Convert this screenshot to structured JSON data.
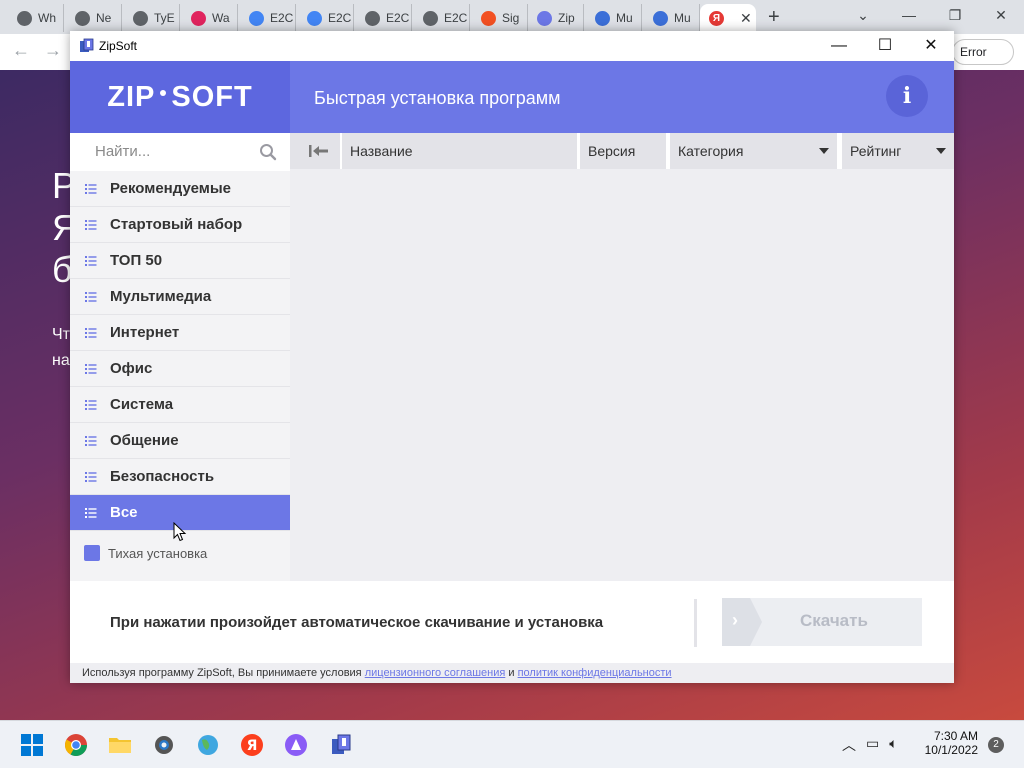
{
  "browser": {
    "tabs": [
      {
        "label": "Wh",
        "color": "#5f6368"
      },
      {
        "label": "Ne",
        "color": "#5f6368"
      },
      {
        "label": "TyE",
        "color": "#5f6368"
      },
      {
        "label": "Wa",
        "color": "#e0245e"
      },
      {
        "label": "E2C",
        "color": "#4285f4"
      },
      {
        "label": "E2C",
        "color": "#4285f4"
      },
      {
        "label": "E2C",
        "color": "#5f6368"
      },
      {
        "label": "E2C",
        "color": "#5f6368"
      },
      {
        "label": "Sig",
        "color": "#f25022"
      },
      {
        "label": "Zip",
        "color": "#6c77e6"
      },
      {
        "label": "Mu",
        "color": "#3b6fd8"
      },
      {
        "label": "Mu",
        "color": "#3b6fd8"
      },
      {
        "label": "",
        "color": "#e53935",
        "active": true
      }
    ],
    "active_tab_favicon_letter": "Я",
    "error_chip": "Error",
    "bg_text_lines": [
      "Р",
      "Я",
      "б"
    ],
    "bg_small_lines": [
      "Чт",
      "на"
    ]
  },
  "window": {
    "title": "ZipSoft",
    "controls": {
      "minimize": "—",
      "maximize": "☐",
      "close": "✕"
    }
  },
  "header": {
    "logo_left": "ZIP",
    "logo_right": "SOFT",
    "title": "Быстрая установка программ",
    "info_icon": "i"
  },
  "sidebar": {
    "search_placeholder": "Найти...",
    "items": [
      {
        "label": "Рекомендуемые"
      },
      {
        "label": "Стартовый набор"
      },
      {
        "label": "ТОП 50"
      },
      {
        "label": "Мультимедиа"
      },
      {
        "label": "Интернет"
      },
      {
        "label": "Офис"
      },
      {
        "label": "Система"
      },
      {
        "label": "Общение"
      },
      {
        "label": "Безопасность"
      },
      {
        "label": "Все",
        "selected": true
      }
    ],
    "silent_install_label": "Тихая установка"
  },
  "table": {
    "columns": {
      "name": "Название",
      "version": "Версия",
      "category": "Категория",
      "rating": "Рейтинг"
    }
  },
  "footer": {
    "message": "При нажатии произойдет автоматическое скачивание и установка",
    "download_label": "Скачать"
  },
  "license": {
    "prefix": "Используя программу ZipSoft, Вы принимаете условия ",
    "link1": "лицензионного соглашения",
    "middle": " и ",
    "link2": "политик конфиденциальности"
  },
  "taskbar": {
    "time": "7:30 AM",
    "date": "10/1/2022",
    "notifications": "2"
  },
  "colors": {
    "accent": "#6c77e6",
    "accent_dark": "#5d67df"
  }
}
